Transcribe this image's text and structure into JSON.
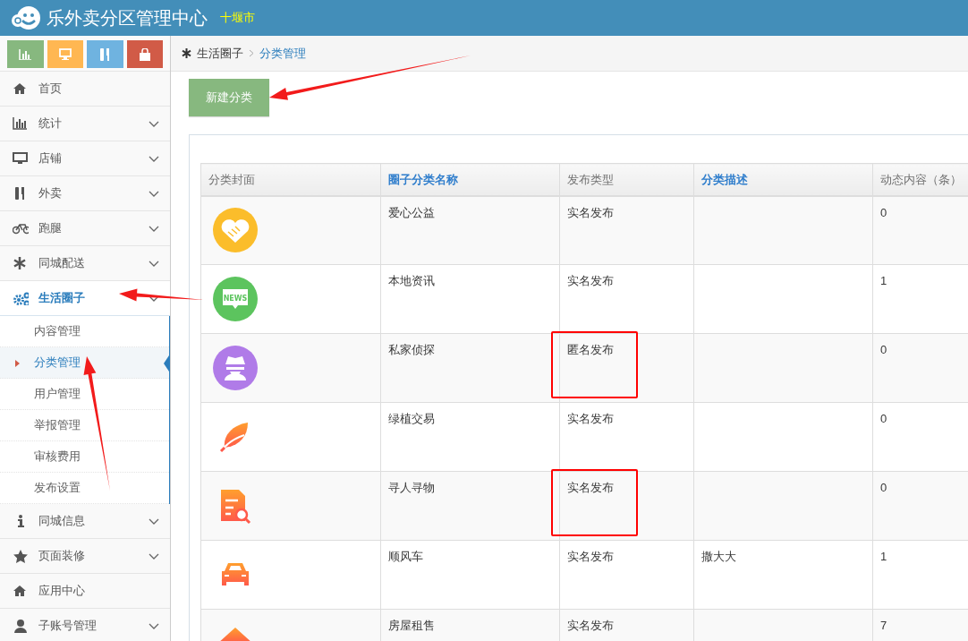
{
  "header": {
    "title": "乐外卖分区管理中心",
    "city": "十堰市"
  },
  "shortcuts": [
    {
      "color": "#87b87f"
    },
    {
      "color": "#ffb752"
    },
    {
      "color": "#6fb3e0"
    },
    {
      "color": "#d15b47"
    }
  ],
  "menu": [
    {
      "label": "首页",
      "expandable": false,
      "active": false,
      "expanded": false,
      "annotated": false
    },
    {
      "label": "统计",
      "expandable": true,
      "active": false,
      "expanded": false,
      "annotated": false
    },
    {
      "label": "店铺",
      "expandable": true,
      "active": false,
      "expanded": false,
      "annotated": false
    },
    {
      "label": "外卖",
      "expandable": true,
      "active": false,
      "expanded": false,
      "annotated": false
    },
    {
      "label": "跑腿",
      "expandable": true,
      "active": false,
      "expanded": false,
      "annotated": false
    },
    {
      "label": "同城配送",
      "expandable": true,
      "active": false,
      "expanded": false,
      "annotated": false
    },
    {
      "label": "生活圈子",
      "expandable": true,
      "active": true,
      "expanded": true,
      "annotated": true,
      "children": [
        {
          "label": "内容管理",
          "selected": false,
          "annotated": false
        },
        {
          "label": "分类管理",
          "selected": true,
          "annotated": true
        },
        {
          "label": "用户管理",
          "selected": false,
          "annotated": false
        },
        {
          "label": "举报管理",
          "selected": false,
          "annotated": false
        },
        {
          "label": "审核费用",
          "selected": false,
          "annotated": false
        },
        {
          "label": "发布设置",
          "selected": false,
          "annotated": false
        }
      ]
    },
    {
      "label": "同城信息",
      "expandable": true,
      "active": false,
      "expanded": false,
      "annotated": false
    },
    {
      "label": "页面装修",
      "expandable": true,
      "active": false,
      "expanded": false,
      "annotated": false
    },
    {
      "label": "应用中心",
      "expandable": false,
      "active": false,
      "expanded": false,
      "annotated": false
    },
    {
      "label": "子账号管理",
      "expandable": true,
      "active": false,
      "expanded": false,
      "annotated": false
    }
  ],
  "breadcrumb": [
    {
      "label": "生活圈子",
      "current": false
    },
    {
      "label": "分类管理",
      "current": true
    }
  ],
  "new_button": {
    "label": "新建分类",
    "annotated": true
  },
  "table": {
    "columns": [
      {
        "label": "分类封面",
        "sortable": false
      },
      {
        "label": "圈子分类名称",
        "sortable": true
      },
      {
        "label": "发布类型",
        "sortable": false
      },
      {
        "label": "分类描述",
        "sortable": true
      },
      {
        "label": "动态内容（条）",
        "sortable": false
      }
    ],
    "rows": [
      {
        "name": "爱心公益",
        "type": "实名发布",
        "description": "",
        "count": "0",
        "highlighted": false
      },
      {
        "name": "本地资讯",
        "type": "实名发布",
        "description": "",
        "count": "1",
        "highlighted": false,
        "cover_text": "NEWS"
      },
      {
        "name": "私家侦探",
        "type": "匿名发布",
        "description": "",
        "count": "0",
        "highlighted": true
      },
      {
        "name": "绿植交易",
        "type": "实名发布",
        "description": "",
        "count": "0",
        "highlighted": false
      },
      {
        "name": "寻人寻物",
        "type": "实名发布",
        "description": "",
        "count": "0",
        "highlighted": true
      },
      {
        "name": "顺风车",
        "type": "实名发布",
        "description": "撒大大",
        "count": "1",
        "highlighted": false
      },
      {
        "name": "房屋租售",
        "type": "实名发布",
        "description": "",
        "count": "7",
        "highlighted": false
      }
    ]
  }
}
